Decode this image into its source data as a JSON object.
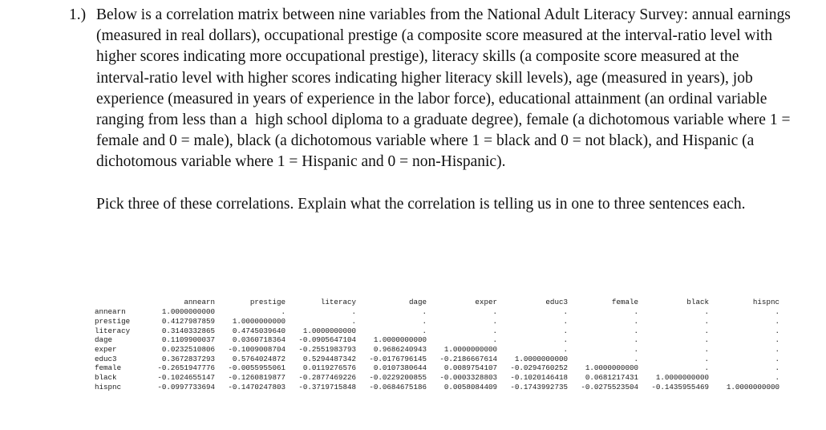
{
  "question": {
    "number": "1.)",
    "paragraph_1": "Below is a correlation matrix between nine variables from the National Adult Literacy Survey: annual earnings (measured in real dollars), occupational prestige (a composite score measured at the interval-ratio level with higher scores indicating more occupational prestige), literacy skills (a composite score measured at the interval-ratio level with higher scores indicating higher literacy skill levels), age (measured in years), job experience (measured in years of experience in the labor force), educational attainment (an ordinal variable ranging from less than a  high school diploma to a graduate degree), female (a dichotomous variable where 1 = female and 0 = male), black (a dichotomous variable where 1 = black and 0 = not black), and Hispanic (a dichotomous variable where 1 = Hispanic and 0 = non-Hispanic).",
    "paragraph_2": "Pick three of these correlations. Explain what the correlation is telling us in one to three sentences each."
  },
  "matrix": {
    "empty_corner": "",
    "missing_symbol": ".",
    "columns": [
      "annearn",
      "prestige",
      "literacy",
      "dage",
      "exper",
      "educ3",
      "female",
      "black",
      "hispnc"
    ],
    "rows": [
      {
        "label": "annearn",
        "values": [
          "1.0000000000",
          ".",
          ".",
          ".",
          ".",
          ".",
          ".",
          ".",
          "."
        ]
      },
      {
        "label": "prestige",
        "values": [
          "0.4127987859",
          "1.0000000000",
          ".",
          ".",
          ".",
          ".",
          ".",
          ".",
          "."
        ]
      },
      {
        "label": "literacy",
        "values": [
          "0.3140332865",
          "0.4745039640",
          "1.0000000000",
          ".",
          ".",
          ".",
          ".",
          ".",
          "."
        ]
      },
      {
        "label": "dage",
        "values": [
          "0.1109900037",
          "0.0360718364",
          "-0.0905647104",
          "1.0000000000",
          ".",
          ".",
          ".",
          ".",
          "."
        ]
      },
      {
        "label": "exper",
        "values": [
          "0.0232510806",
          "-0.1009008704",
          "-0.2551983793",
          "0.9686240943",
          "1.0000000000",
          ".",
          ".",
          ".",
          "."
        ]
      },
      {
        "label": "educ3",
        "values": [
          "0.3672837293",
          "0.5764024872",
          "0.5294487342",
          "-0.0176796145",
          "-0.2186667614",
          "1.0000000000",
          ".",
          ".",
          "."
        ]
      },
      {
        "label": "female",
        "values": [
          "-0.2651947776",
          "-0.0055955061",
          "0.0119276576",
          "0.0107380644",
          "0.0089754107",
          "-0.0294760252",
          "1.0000000000",
          ".",
          "."
        ]
      },
      {
        "label": "black",
        "values": [
          "-0.1024655147",
          "-0.1260819877",
          "-0.2877469226",
          "-0.0229200855",
          "-0.0003328803",
          "-0.1020146418",
          "0.0681217431",
          "1.0000000000",
          "."
        ]
      },
      {
        "label": "hispnc",
        "values": [
          "-0.0997733694",
          "-0.1470247803",
          "-0.3719715848",
          "-0.0684675186",
          "0.0058084409",
          "-0.1743992735",
          "-0.0275523504",
          "-0.1435955469",
          "1.0000000000"
        ]
      }
    ]
  }
}
